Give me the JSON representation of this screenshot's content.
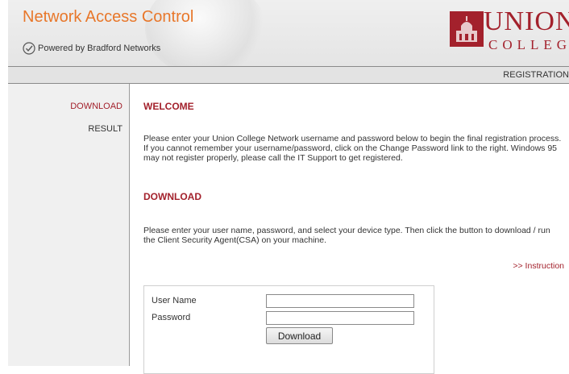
{
  "header": {
    "app_title": "Network Access Control",
    "powered_by": "Powered by Bradford Networks",
    "logo": {
      "line1": "UNION",
      "line2": "COLLEGE"
    }
  },
  "navbar": {
    "label": "REGISTRATION"
  },
  "sidebar": {
    "items": [
      {
        "label": "DOWNLOAD",
        "active": true
      },
      {
        "label": "RESULT",
        "active": false
      }
    ]
  },
  "main": {
    "welcome": {
      "title": "WELCOME",
      "text": "Please enter your Union College Network username and password below to begin the final registration process. If you cannot remember your username/password, click on the Change Password link to the right. Windows 95 may not register properly, please call the IT Support to get registered."
    },
    "download": {
      "title": "DOWNLOAD",
      "text": "Please enter your user name, password, and select your device type. Then click the button to download / run the Client Security Agent(CSA) on your machine.",
      "instruction_link": ">> Instruction"
    },
    "form": {
      "username_label": "User Name",
      "username_value": "",
      "password_label": "Password",
      "password_value": "",
      "button_label": "Download"
    }
  },
  "colors": {
    "accent_orange": "#e8772a",
    "brand_red": "#a3212c",
    "sidebar_bg": "#f0f0f0"
  }
}
